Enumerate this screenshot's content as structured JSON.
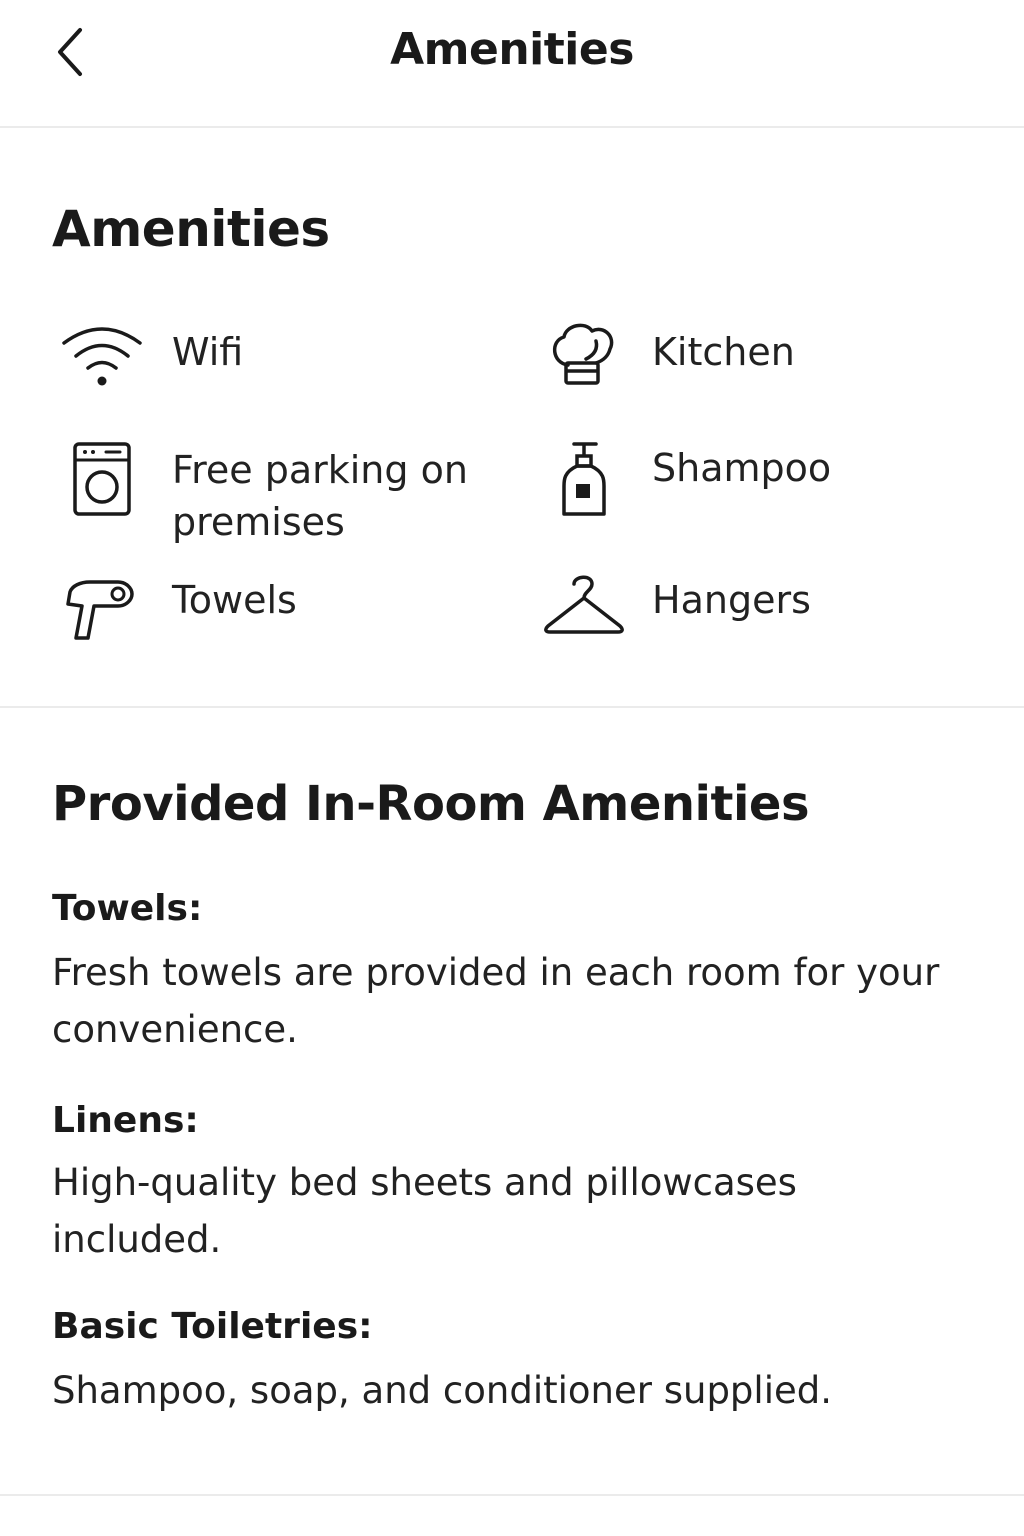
{
  "header": {
    "title": "Amenities",
    "back_icon": "chevron-left-icon"
  },
  "amenities_section": {
    "title": "Amenities",
    "items": [
      {
        "label": "Wifi",
        "icon": "wifi-icon"
      },
      {
        "label": "Kitchen",
        "icon": "chef-hat-icon"
      },
      {
        "label": "Free parking on premises",
        "icon": "washing-machine-icon"
      },
      {
        "label": "Shampoo",
        "icon": "shampoo-bottle-icon"
      },
      {
        "label": "Towels",
        "icon": "hair-dryer-icon"
      },
      {
        "label": "Hangers",
        "icon": "hanger-icon"
      }
    ]
  },
  "in_room_section": {
    "title": "Provided In-Room Amenities",
    "details": [
      {
        "title": "Towels:",
        "text": "Fresh towels are provided in each room for your convenience."
      },
      {
        "title": "Linens:",
        "text": "High-quality bed sheets and pillowcases included."
      },
      {
        "title": "Basic Toiletries:",
        "text": "Shampoo, soap, and conditioner supplied."
      }
    ]
  },
  "colors": {
    "text": "#1a1a1a",
    "divider": "#ebebeb",
    "background": "#ffffff"
  }
}
